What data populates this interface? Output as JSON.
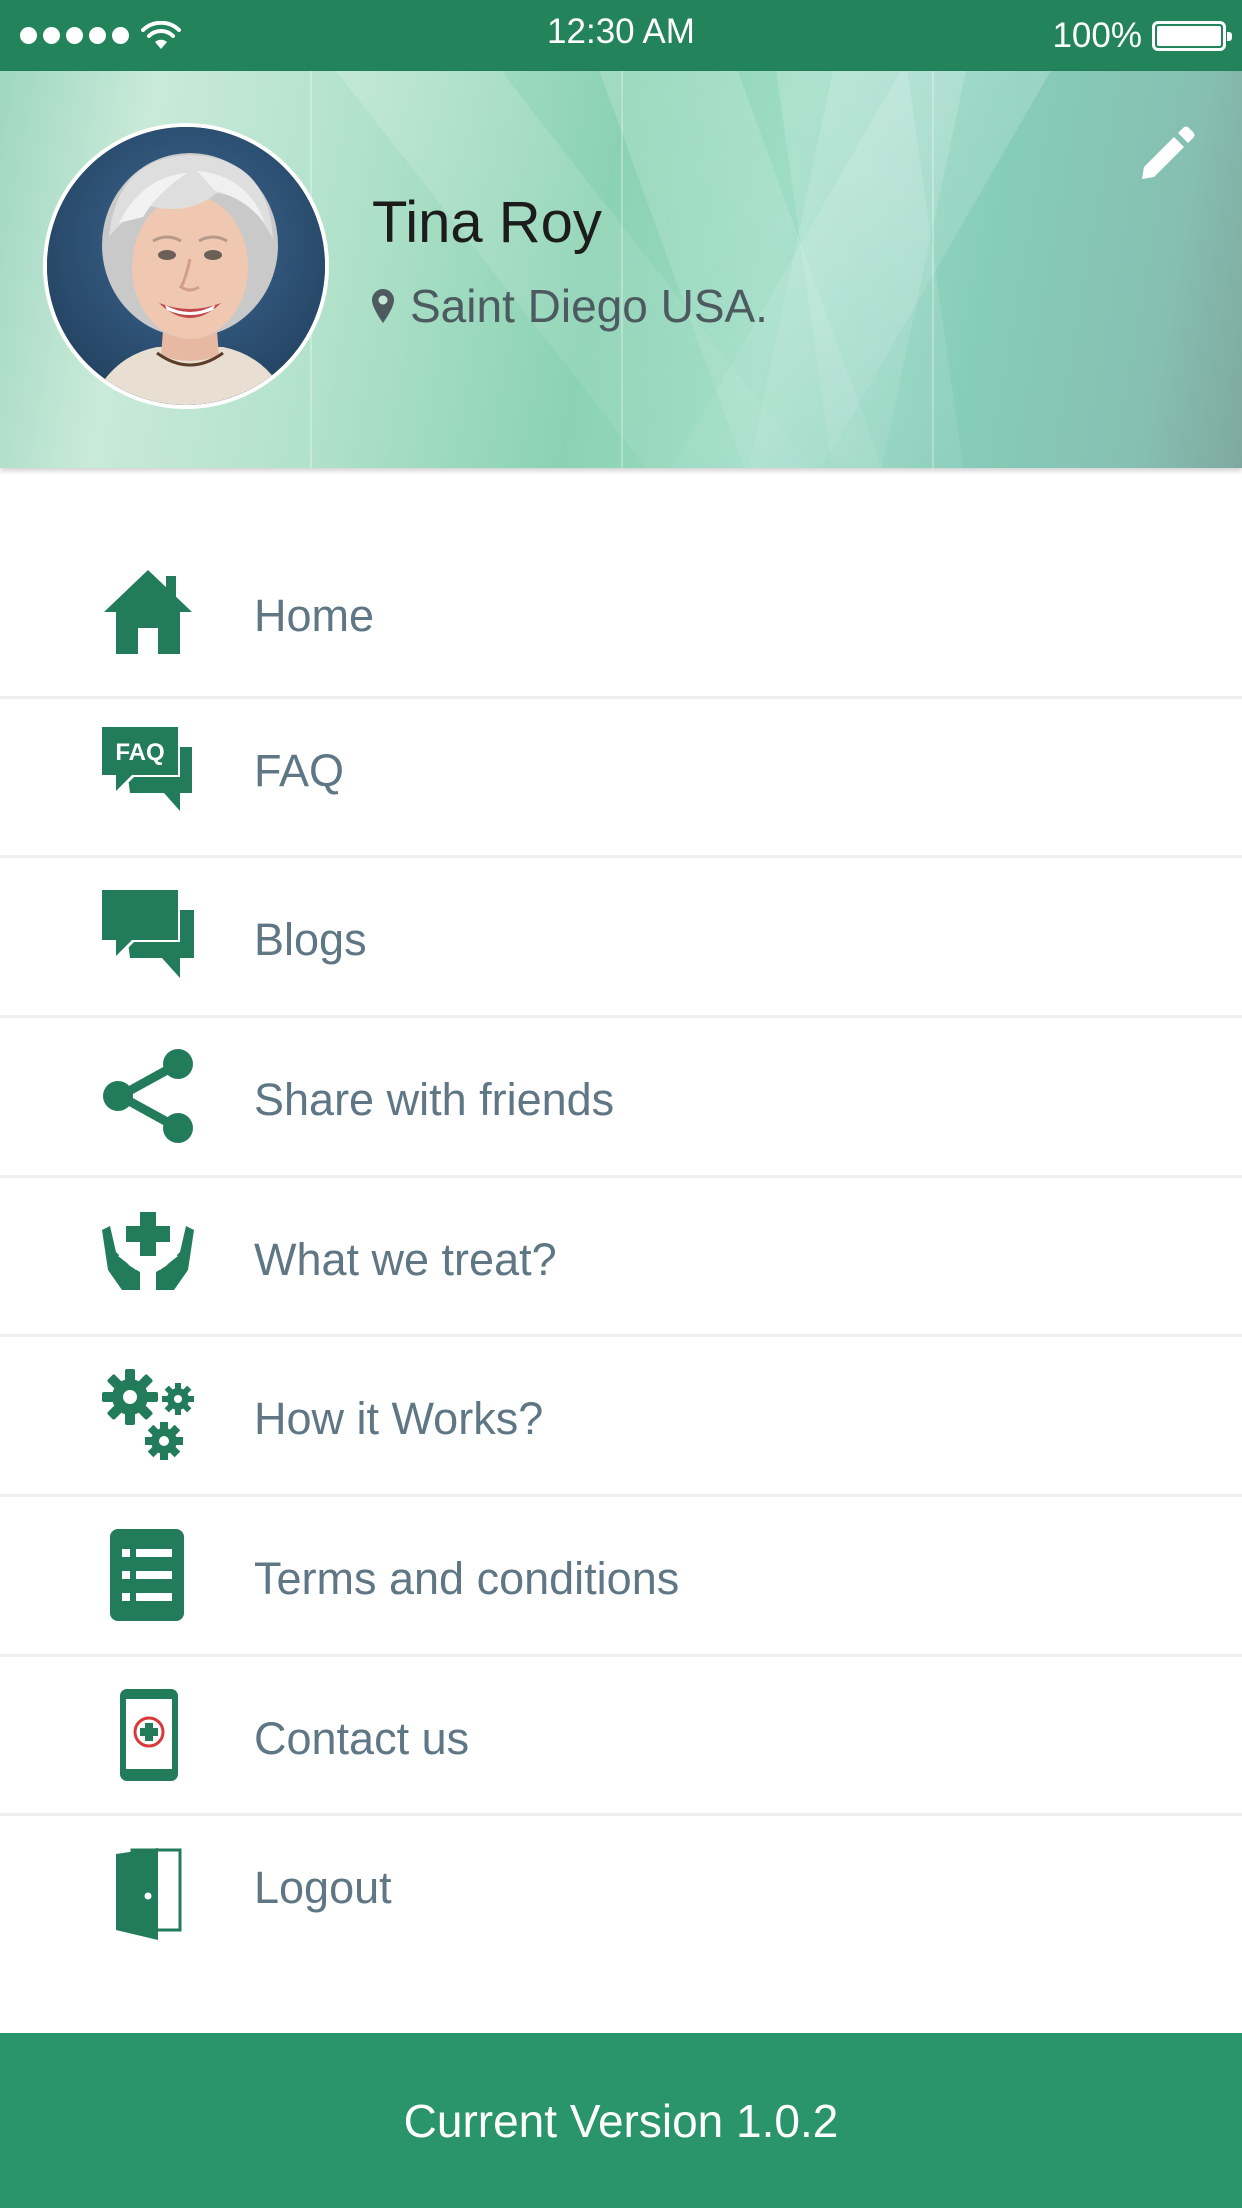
{
  "status_bar": {
    "time": "12:30 AM",
    "battery_percent": "100%",
    "signal_dots": 5,
    "wifi_icon": "wifi-icon",
    "battery_level": 1.0
  },
  "profile": {
    "name": "Tina Roy",
    "location": "Saint Diego USA.",
    "location_icon": "location-pin-icon",
    "edit_icon": "pencil-icon"
  },
  "menu": {
    "items": [
      {
        "label": "Home",
        "icon": "home-icon"
      },
      {
        "label": "FAQ",
        "icon": "faq-icon",
        "icon_text": "FAQ"
      },
      {
        "label": "Blogs",
        "icon": "chat-bubbles-icon"
      },
      {
        "label": "Share with friends",
        "icon": "share-icon"
      },
      {
        "label": "What we treat?",
        "icon": "hands-medical-cross-icon"
      },
      {
        "label": "How it Works?",
        "icon": "gears-icon"
      },
      {
        "label": "Terms and conditions",
        "icon": "document-list-icon"
      },
      {
        "label": "Contact us",
        "icon": "phone-medical-icon"
      },
      {
        "label": "Logout",
        "icon": "door-exit-icon"
      }
    ]
  },
  "footer": {
    "version_text": "Current Version 1.0.2"
  },
  "colors": {
    "status_bar": "#23835a",
    "accent_green": "#227b5b",
    "footer": "#2a946b",
    "menu_text": "#5f7684",
    "divider": "#eef0ef"
  }
}
